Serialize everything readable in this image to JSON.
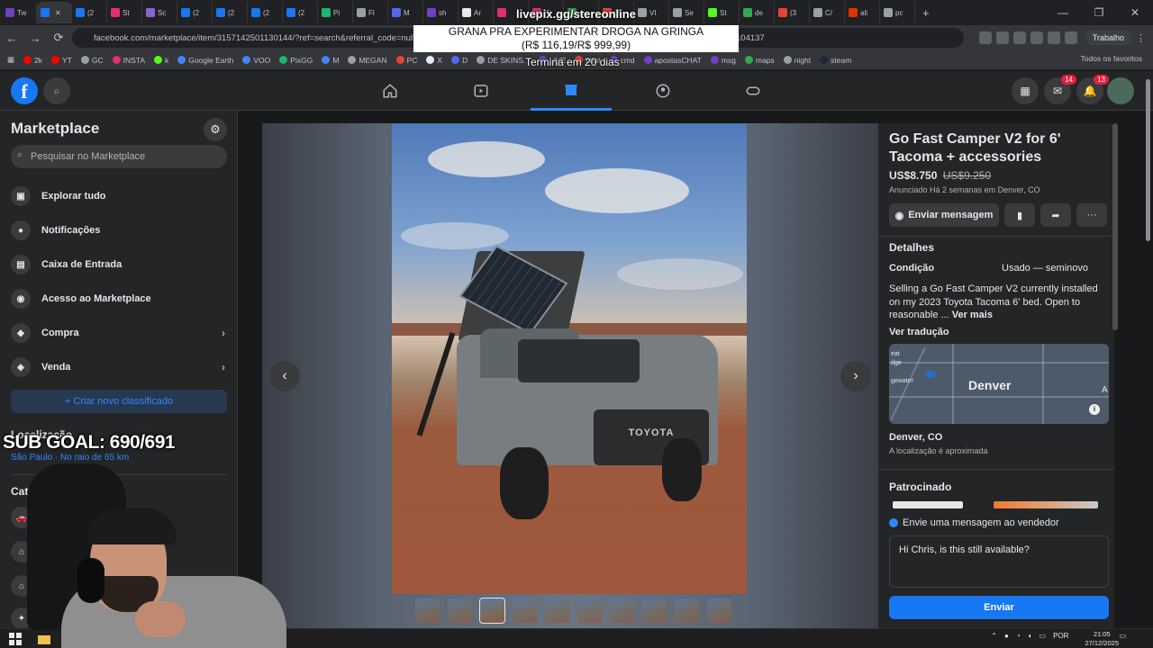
{
  "browser": {
    "tabs": [
      {
        "label": "Tw",
        "color": "#6f42c1"
      },
      {
        "label": "",
        "color": "#1877f2",
        "active": true
      },
      {
        "label": "(2",
        "color": "#1877f2"
      },
      {
        "label": "St",
        "color": "#e1306c"
      },
      {
        "label": "Sc",
        "color": "#8a63d2"
      },
      {
        "label": "(2",
        "color": "#1877f2"
      },
      {
        "label": "(2",
        "color": "#1877f2"
      },
      {
        "label": "(2",
        "color": "#1877f2"
      },
      {
        "label": "(2",
        "color": "#1877f2"
      },
      {
        "label": "Pi",
        "color": "#1bb76e"
      },
      {
        "label": "Fl",
        "color": "#9aa0a6"
      },
      {
        "label": "M",
        "color": "#5865f2"
      },
      {
        "label": "sh",
        "color": "#6f42c1"
      },
      {
        "label": "Ar",
        "color": "#e8eaed"
      },
      {
        "label": "",
        "color": "#e1306c"
      },
      {
        "label": "(9",
        "color": "#e1306c"
      },
      {
        "label": "av",
        "color": "#34a853"
      },
      {
        "label": "(3",
        "color": "#ea4335"
      },
      {
        "label": "VI",
        "color": "#9aa0a6"
      },
      {
        "label": "Se",
        "color": "#9aa0a6"
      },
      {
        "label": "St",
        "color": "#53fc18"
      },
      {
        "label": "de",
        "color": "#34a853"
      },
      {
        "label": "(3",
        "color": "#ea4335"
      },
      {
        "label": "C/",
        "color": "#9aa0a6"
      },
      {
        "label": "ali",
        "color": "#e62e04"
      },
      {
        "label": "pc",
        "color": "#9aa0a6"
      }
    ],
    "new_tab": "+",
    "url": "facebook.com/marketplace/item/3157142501130144/?ref=search&referral_code=null",
    "url_tail": "104137",
    "profile": "Trabalho",
    "bookmarks": [
      {
        "label": "2k",
        "color": "#ff0000"
      },
      {
        "label": "YT",
        "color": "#ff0000"
      },
      {
        "label": "GC",
        "color": "#9aa0a6"
      },
      {
        "label": "INSTA",
        "color": "#e1306c"
      },
      {
        "label": "k",
        "color": "#53fc18"
      },
      {
        "label": "Google Earth",
        "color": "#4285f4"
      },
      {
        "label": "VOO",
        "color": "#4285f4"
      },
      {
        "label": "PixGG",
        "color": "#1bb76e"
      },
      {
        "label": "M",
        "color": "#4285f4"
      },
      {
        "label": "MEGAN",
        "color": "#9aa0a6"
      },
      {
        "label": "PC",
        "color": "#ea4335"
      },
      {
        "label": "X",
        "color": "#e8eaed"
      },
      {
        "label": "D",
        "color": "#5865f2"
      },
      {
        "label": "DE SKINS...",
        "color": "#9aa0a6"
      },
      {
        "label": "LIVE",
        "color": "#6f42c1"
      },
      {
        "label": "chat",
        "color": "#ea4335"
      },
      {
        "label": "cmd",
        "color": "#6f42c1"
      },
      {
        "label": "apostasCHAT",
        "color": "#6f42c1"
      },
      {
        "label": "msg",
        "color": "#6f42c1"
      },
      {
        "label": "maps",
        "color": "#34a853"
      },
      {
        "label": "night",
        "color": "#9aa0a6"
      },
      {
        "label": "steam",
        "color": "#1b2838"
      }
    ],
    "favorites_folder": "Todos os favoritos"
  },
  "facebook": {
    "logo": "f",
    "notif_badges": {
      "messenger": "14",
      "notifications": "13"
    }
  },
  "sidebar": {
    "title": "Marketplace",
    "search_placeholder": "Pesquisar no Marketplace",
    "items": [
      {
        "label": "Explorar tudo",
        "icon": "storefront-icon"
      },
      {
        "label": "Notificações",
        "icon": "bell-icon"
      },
      {
        "label": "Caixa de Entrada",
        "icon": "inbox-icon"
      },
      {
        "label": "Acesso ao Marketplace",
        "icon": "person-icon"
      },
      {
        "label": "Compra",
        "icon": "bag-icon"
      },
      {
        "label": "Venda",
        "icon": "tag-icon"
      }
    ],
    "create_label": "+ Criar novo classificado",
    "location_heading": "Localização",
    "location_value": "São Paulo · No raio de 65 km",
    "categories_heading": "Categorias"
  },
  "listing": {
    "title": "Go Fast Camper V2 for 6' Tacoma + accessories",
    "price": "US$8.750",
    "old_price": "US$9.250",
    "posted": "Anunciado Há 2 semanas em Denver, CO",
    "message_button": "Enviar mensagem",
    "details_heading": "Detalhes",
    "condition_label": "Condição",
    "condition_value": "Usado — seminovo",
    "description": "Selling a Go Fast Camper V2 currently installed on my 2023 Toyota Tacoma 6' bed. Open to reasonable ...",
    "see_more": "Ver mais",
    "translate": "Ver tradução",
    "map_city": "Denver",
    "map_labels": [
      "eat",
      "dge",
      "gewater",
      "A"
    ],
    "location_name": "Denver, CO",
    "location_note": "A localização é aproximada",
    "sponsored_heading": "Patrocinado",
    "grille_text": "TOYOTA",
    "thumb_count": 10,
    "active_thumb": 3
  },
  "message_card": {
    "label": "Envie uma mensagem ao vendedor",
    "input_value": "Hi Chris, is this still available?",
    "send_label": "Enviar"
  },
  "overlays": {
    "donation_url": "livepix.gg/stereonline",
    "banner_line1": "GRANA PRA EXPERIMENTAR DROGA NA GRINGA",
    "banner_line2": "(R$ 116,19/R$ 999,99)",
    "ends": "Termina em 20 dias",
    "sub_goal": "SUB GOAL: 690/691"
  },
  "taskbar": {
    "lang": "POR",
    "time": "21:05",
    "date": "27/12/2025"
  }
}
